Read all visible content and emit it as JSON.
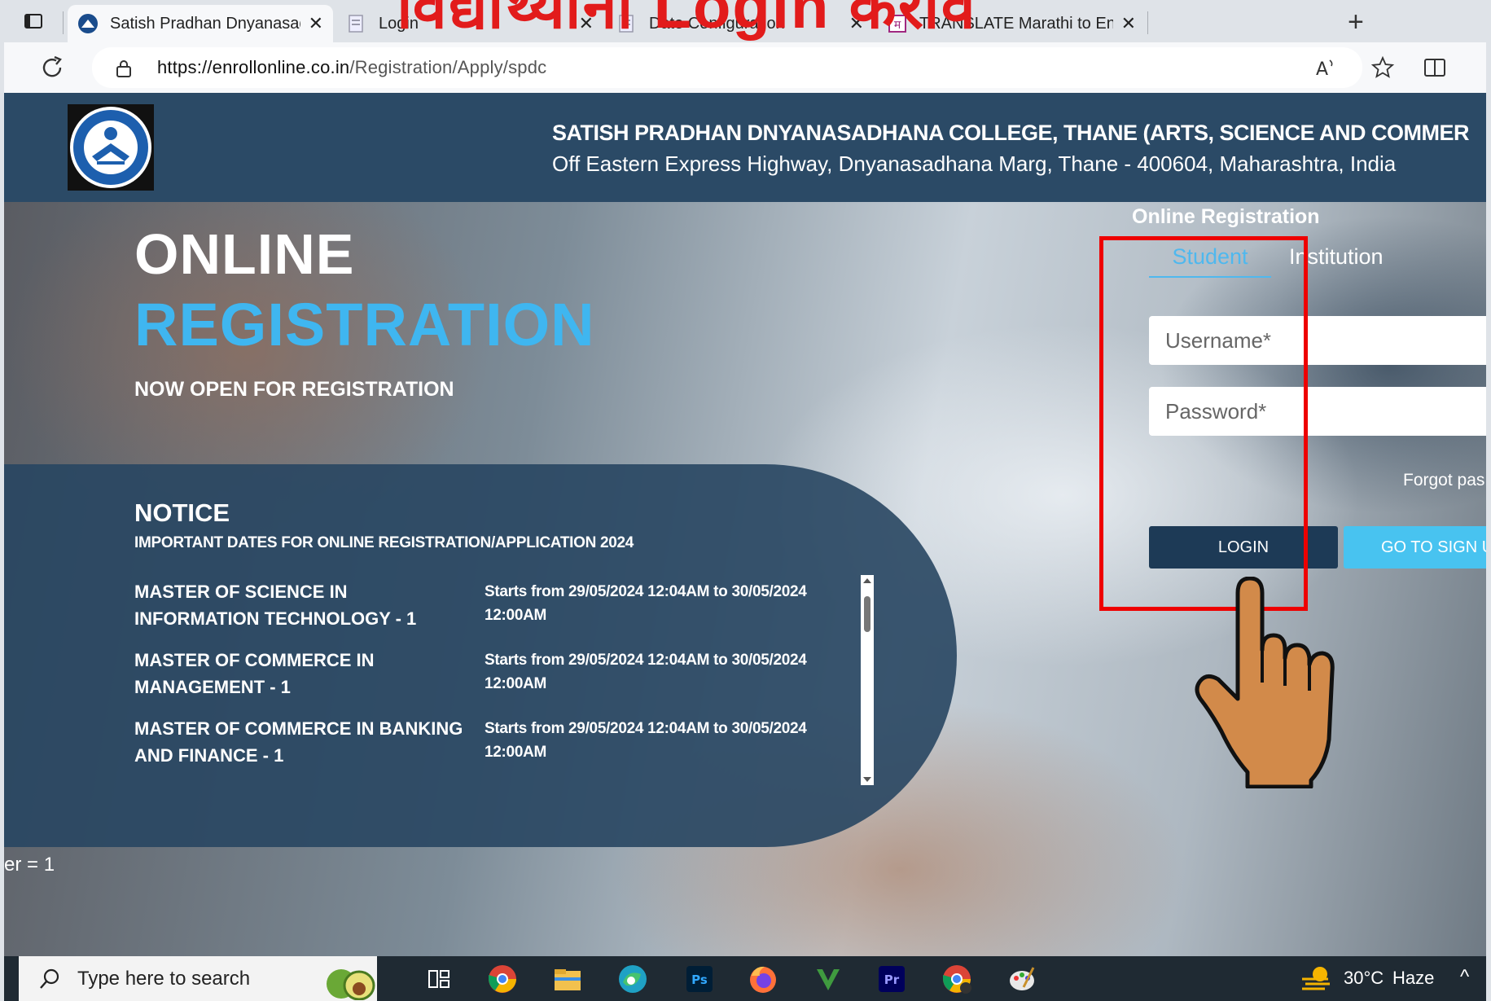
{
  "browser": {
    "tabs": [
      {
        "title": "Satish Pradhan Dnyanasadhana C",
        "active": true
      },
      {
        "title": "Login",
        "active": false
      },
      {
        "title": "Date Configuration",
        "active": false
      },
      {
        "title": "TRANSLATE Marathi to English fo",
        "active": false
      }
    ],
    "url_host": "https://enrollonline.co.in",
    "url_path": "/Registration/Apply/spdc"
  },
  "overlay_caption": "विद्यार्थ्यांना Login करावे",
  "header": {
    "college_name": "SATISH PRADHAN DNYANASADHANA COLLEGE, THANE (ARTS, SCIENCE AND COMMER",
    "address": "Off Eastern Express Highway, Dnyanasadhana Marg, Thane - 400604, Maharashtra, India"
  },
  "hero": {
    "title_line1": "ONLINE",
    "title_line2": "REGISTRATION",
    "subtitle": "NOW OPEN FOR REGISTRATION"
  },
  "notice": {
    "title": "NOTICE",
    "subtitle": "IMPORTANT DATES FOR ONLINE REGISTRATION/APPLICATION 2024",
    "items": [
      {
        "course": "MASTER OF SCIENCE IN INFORMATION TECHNOLOGY - 1",
        "dates": "Starts from 29/05/2024 12:04AM to 30/05/2024 12:00AM"
      },
      {
        "course": "MASTER OF COMMERCE IN MANAGEMENT - 1",
        "dates": "Starts from 29/05/2024 12:04AM to 30/05/2024 12:00AM"
      },
      {
        "course": "MASTER OF COMMERCE IN BANKING AND FINANCE - 1",
        "dates": "Starts from 29/05/2024 12:04AM to 30/05/2024 12:00AM"
      }
    ],
    "stray_text": "er = 1"
  },
  "login": {
    "heading": "Online Registration",
    "tab_student": "Student",
    "tab_institution": "Institution",
    "username_placeholder": "Username*",
    "password_placeholder": "Password*",
    "forgot": "Forgot pas",
    "login_button": "LOGIN",
    "signup_button": "GO TO SIGN UI"
  },
  "taskbar": {
    "search_placeholder": "Type here to search",
    "weather_temp": "30°C",
    "weather_desc": "Haze",
    "apps": [
      "task-view",
      "chrome",
      "file-explorer",
      "edge",
      "photoshop",
      "firefox",
      "vectr",
      "premiere",
      "chrome-alt",
      "paint"
    ]
  },
  "colors": {
    "header_bg": "#2b4a66",
    "accent_blue": "#3fb6f0",
    "login_button": "#1d3a56",
    "signup_button": "#48c3f0",
    "highlight_red": "#e00000"
  }
}
